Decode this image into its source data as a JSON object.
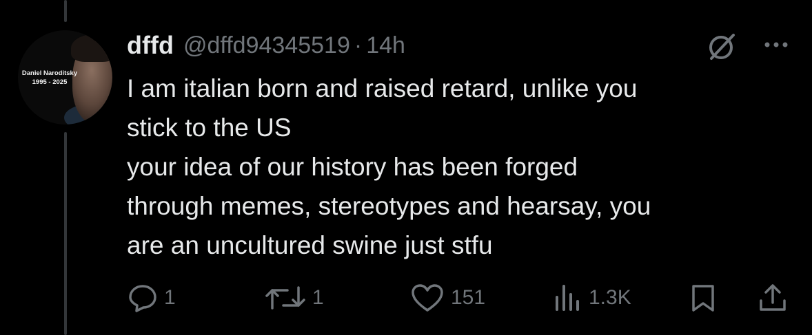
{
  "colors": {
    "background": "#000000",
    "text": "#e7e9ea",
    "muted": "#71767b",
    "thread_line": "#333639"
  },
  "author": {
    "avatar_text": {
      "line1": "Daniel Naroditsky",
      "line2": "1995 - 2025"
    },
    "name": "dffd",
    "handle": "@dffd94345519",
    "separator": "·",
    "time": "14h"
  },
  "tweet": {
    "text": "I am italian born and raised retard, unlike you\nstick to the US\nyour idea of our history has been forged\nthrough memes, stereotypes and hearsay, you\nare an uncultured swine just stfu"
  },
  "header_icons": {
    "grok": "grok-icon",
    "more": "more-icon"
  },
  "actions": {
    "reply": {
      "icon": "reply-icon",
      "count": "1"
    },
    "retweet": {
      "icon": "retweet-icon",
      "count": "1"
    },
    "like": {
      "icon": "heart-icon",
      "count": "151"
    },
    "views": {
      "icon": "views-icon",
      "count": "1.3K"
    },
    "bookmark": {
      "icon": "bookmark-icon"
    },
    "share": {
      "icon": "share-icon"
    }
  }
}
